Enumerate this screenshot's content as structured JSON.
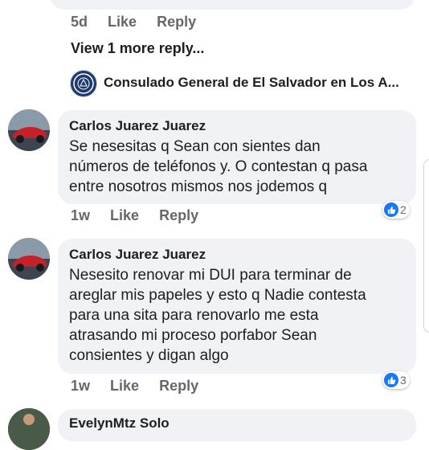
{
  "top": {
    "time": "5d",
    "like": "Like",
    "reply": "Reply"
  },
  "view_more": "View 1 more reply...",
  "page_reply": {
    "name": "Consulado General de El Salvador en Los A..."
  },
  "comments": [
    {
      "author": "Carlos Juarez Juarez",
      "lines": [
        "Se nesesitas q Sean con sientes dan",
        "números de teléfonos y. O contestan q pasa",
        "entre nosotros mismos nos jodemos q"
      ],
      "time": "1w",
      "like": "Like",
      "reply": "Reply",
      "reactions": "2"
    },
    {
      "author": "Carlos Juarez Juarez",
      "lines": [
        "Nesesito renovar mi DUI para terminar de",
        "areglar mis papeles y esto q Nadie contesta",
        "para una sita para renovarlo me esta",
        "atrasando mi proceso porfabor Sean",
        "consientes y digan algo"
      ],
      "time": "1w",
      "like": "Like",
      "reply": "Reply",
      "reactions": "3"
    }
  ],
  "bottom": {
    "author": "EvelynMtz Solo"
  },
  "colors": {
    "bubble": "#f0f2f5",
    "meta_text": "#65676b",
    "like_blue": "#1877f2"
  }
}
